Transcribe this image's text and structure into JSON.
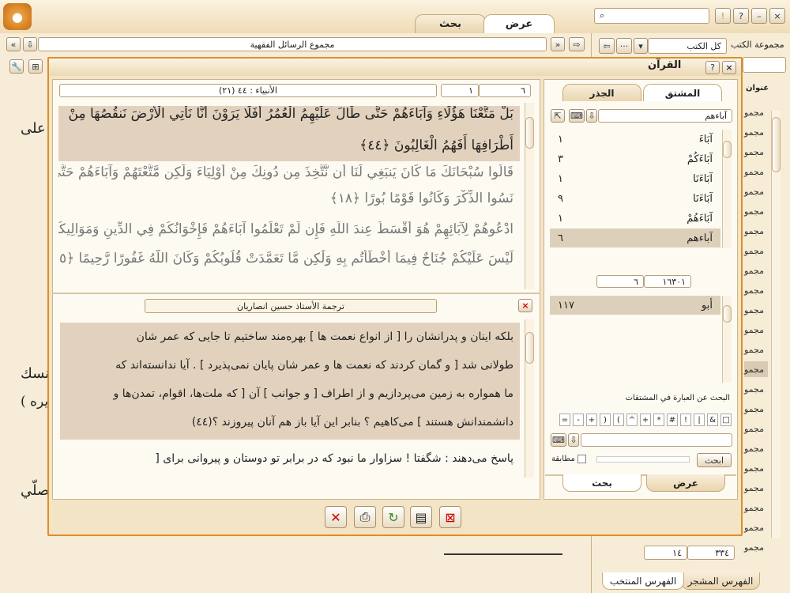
{
  "main_tabs": {
    "view": "عرض",
    "search": "بحث"
  },
  "collections": {
    "label": "مجموعة الكتب",
    "selected": "كل الكتب",
    "title_col": "عنوان",
    "items": [
      "مجمو",
      "مجمو",
      "مجمو",
      "مجمو",
      "مجمو",
      "مجمو",
      "مجمو",
      "مجمو",
      "مجمو",
      "مجمو",
      "مجمو",
      "مجمو",
      "مجمو",
      "مجمو",
      "مجمو",
      "مجمو",
      "مجمو",
      "مجمو",
      "مجمو",
      "مجمو",
      "مجمو",
      "مجمو",
      "مجمو"
    ],
    "counter_left": "١٤",
    "counter_right": "٣٣٤",
    "tab_fahras_muntakhab": "الفهرس المنتخب",
    "tab_fahras_mushajjar": "الفهرس المشجر"
  },
  "book_title": "مجموع الرسائل الفقهية",
  "bg_text": {
    "t1": "على",
    "t2": "نسك",
    "t3": "يره )",
    "t4": "صلّي"
  },
  "window": {
    "title": "القرآن",
    "close": "×",
    "help": "?"
  },
  "ayah_nav": {
    "page": "٦",
    "ayah": "١",
    "sura": "(٢١) الأنبياء : ٤٤"
  },
  "quran_lines": [
    "بَلْ مَتَّعْنَا هَؤُلَاءِ وَآبَاءَهُمْ حَتَّى طَالَ عَلَيْهِمُ الْعُمُرُ أَفَلَا يَرَوْنَ أَنَّا نَأْتِي الْأَرْضَ نَنقُصُهَا مِنْ",
    "أَطْرَافِهَا أَفَهُمُ الْغَالِبُونَ ﴿٤٤﴾",
    "قَالُوا سُبْحَانَكَ مَا كَانَ يَنبَغِي لَنَا أَن نَّتَّخِذَ مِن دُونِكَ مِنْ أَوْلِيَاءَ وَلَٰكِن مَّتَّعْتَهُمْ وَآبَاءَهُمْ حَتَّى",
    "نَسُوا الذِّكْرَ وَكَانُوا قَوْمًا بُورًا ﴿١٨﴾",
    "ادْعُوهُمْ لِآبَائِهِمْ هُوَ أَقْسَطُ عِندَ اللَّهِ فَإِن لَّمْ تَعْلَمُوا آبَاءَهُمْ فَإِخْوَانُكُمْ فِي الدِّينِ وَمَوَالِيكُمْ وَ",
    "لَيْسَ عَلَيْكُمْ جُنَاحٌ فِيمَا أَخْطَأْتُم بِهِ وَلَٰكِن مَّا تَعَمَّدَتْ قُلُوبُكُمْ وَكَانَ اللَّهُ غَفُورًا رَّحِيمًا ﴿٥﴾"
  ],
  "translation": {
    "title": "ترجمة الأستاذ حسين انصاريان",
    "lines": [
      "بلكه اينان و پدرانشان را [ از انواع نعمت ها ] بهره‌مند ساختيم تا جايى كه عمر شان",
      "طولانى شد [ و گمان كردند كه نعمت ها و عمر شان پايان نمى‌پذيرد ] . آيا ندانسته‌اند كه",
      "ما همواره به زمين مى‌پردازيم و از اطراف [ و جوانب ] آن [ كه ملت‌ها، اقوام، تمدن‌ها و",
      "دانشمندانش هستند ] مى‌كاهيم ؟ بنابر اين آيا باز هم آنان پيروزند ؟(٤٤)",
      "پاسخ مى‌دهند : شگفتا ! سزاوار ما نبود كه در برابر تو دوستان و پيروانى براى ["
    ]
  },
  "side": {
    "tab_derived": "المشتق",
    "tab_root": "الجذر",
    "search_word": "آباءهم",
    "derived": [
      {
        "word": "آبَاءَ",
        "count": "١"
      },
      {
        "word": "آبَاءَكُمْ",
        "count": "٣"
      },
      {
        "word": "آبَاءَنَا",
        "count": "١"
      },
      {
        "word": "آبَاءَنَا",
        "count": "٩"
      },
      {
        "word": "آبَاءَهُمْ",
        "count": "١"
      },
      {
        "word": "آباءهم",
        "count": "٦"
      }
    ],
    "nav_left": "٦",
    "nav_right": "١٦٣٠١",
    "roots": [
      {
        "word": "أبو",
        "count": "١١٧"
      }
    ],
    "search_label": "البحث عن العبارة في المشتقات",
    "operators": [
      "□",
      "&",
      "|",
      "!",
      "#",
      "*",
      "+",
      "^",
      "(",
      ")",
      "+",
      "-",
      "="
    ],
    "search_btn": "ابحث",
    "match_label": "مطابقة",
    "bottom_tab_view": "عرض",
    "bottom_tab_search": "بحث"
  },
  "colors": {
    "accent": "#d9902a",
    "highlight": "#e2d2bd",
    "name_blue": "#3b3bd0"
  }
}
